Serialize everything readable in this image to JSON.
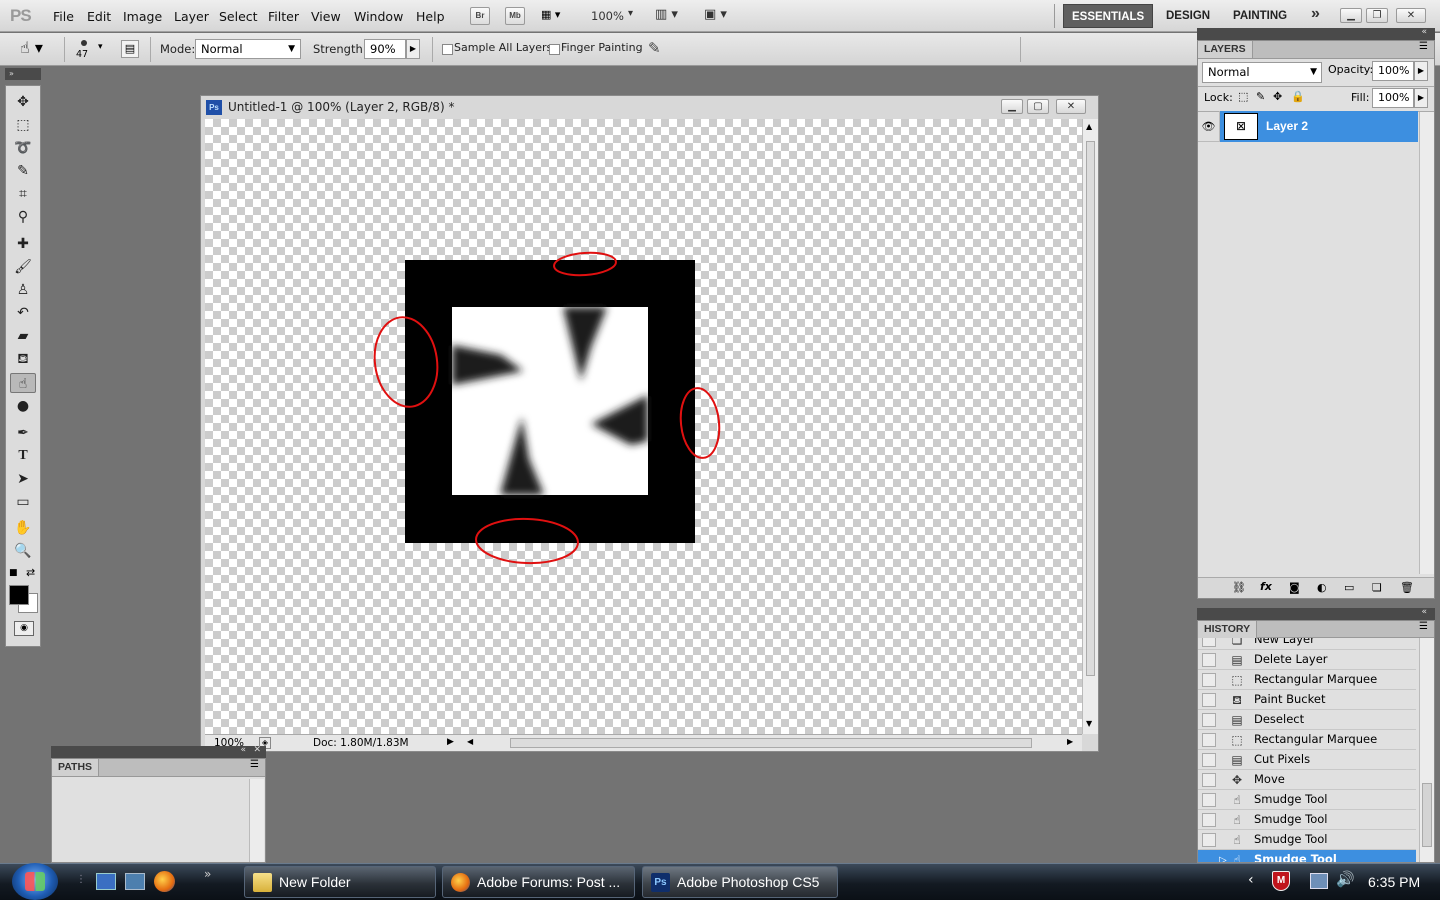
{
  "app": {
    "name": "PS"
  },
  "menubar": {
    "items": [
      "File",
      "Edit",
      "Image",
      "Layer",
      "Select",
      "Filter",
      "View",
      "Window",
      "Help"
    ],
    "bridge_label": "Br",
    "minibridge_label": "Mb",
    "zoom": "100%",
    "more_icon": "»",
    "workspaces": [
      "ESSENTIALS",
      "DESIGN",
      "PAINTING"
    ],
    "window_controls": [
      "minimize-icon",
      "restore-icon",
      "close-icon"
    ]
  },
  "options_bar": {
    "brush_size": "47",
    "mode_label": "Mode:",
    "mode_value": "Normal",
    "strength_label": "Strength:",
    "strength_value": "90%",
    "sample_all_layers": "Sample All Layers",
    "finger_painting": "Finger Painting"
  },
  "toolbox": {
    "tools": [
      "move-tool",
      "rectangular-marquee-tool",
      "lasso-tool",
      "quick-selection-tool",
      "crop-tool",
      "eyedropper-tool",
      "spot-healing-tool",
      "brush-tool",
      "clone-stamp-tool",
      "history-brush-tool",
      "eraser-tool",
      "paint-bucket-tool",
      "smudge-tool",
      "dodge-tool",
      "pen-tool",
      "type-tool",
      "path-selection-tool",
      "rectangle-tool",
      "hand-tool",
      "zoom-tool"
    ],
    "active_tool": "smudge-tool",
    "foreground_color": "#000000",
    "background_color": "#ffffff"
  },
  "document": {
    "title": "Untitled-1 @ 100% (Layer 2, RGB/8) *",
    "zoom": "100%",
    "doc_info": "Doc: 1.80M/1.83M"
  },
  "layers_panel": {
    "tab": "LAYERS",
    "blend_mode": "Normal",
    "opacity_label": "Opacity:",
    "opacity": "100%",
    "lock_label": "Lock:",
    "fill_label": "Fill:",
    "fill": "100%",
    "layers": [
      {
        "name": "Layer 2",
        "visible": true,
        "selected": true
      }
    ],
    "footer_icons": [
      "link-icon",
      "fx-icon",
      "mask-icon",
      "adjustment-icon",
      "group-icon",
      "new-layer-icon",
      "trash-icon"
    ]
  },
  "history_panel": {
    "tab": "HISTORY",
    "items": [
      {
        "label": "New Layer",
        "icon": "new-layer-icon"
      },
      {
        "label": "Delete Layer",
        "icon": "delete-layer-icon"
      },
      {
        "label": "Rectangular Marquee",
        "icon": "marquee-icon"
      },
      {
        "label": "Paint Bucket",
        "icon": "paint-bucket-icon"
      },
      {
        "label": "Deselect",
        "icon": "deselect-icon"
      },
      {
        "label": "Rectangular Marquee",
        "icon": "marquee-icon"
      },
      {
        "label": "Cut Pixels",
        "icon": "cut-pixels-icon"
      },
      {
        "label": "Move",
        "icon": "move-icon"
      },
      {
        "label": "Smudge Tool",
        "icon": "smudge-icon"
      },
      {
        "label": "Smudge Tool",
        "icon": "smudge-icon"
      },
      {
        "label": "Smudge Tool",
        "icon": "smudge-icon"
      },
      {
        "label": "Smudge Tool",
        "icon": "smudge-icon"
      }
    ],
    "selected_index": 11
  },
  "paths_panel": {
    "tab": "PATHS"
  },
  "taskbar": {
    "buttons": [
      {
        "label": "New Folder",
        "icon": "folder-icon"
      },
      {
        "label": "Adobe Forums: Post ...",
        "icon": "firefox-icon"
      },
      {
        "label": "Adobe Photoshop CS5",
        "icon": "photoshop-icon"
      }
    ],
    "clock": "6:35 PM"
  }
}
